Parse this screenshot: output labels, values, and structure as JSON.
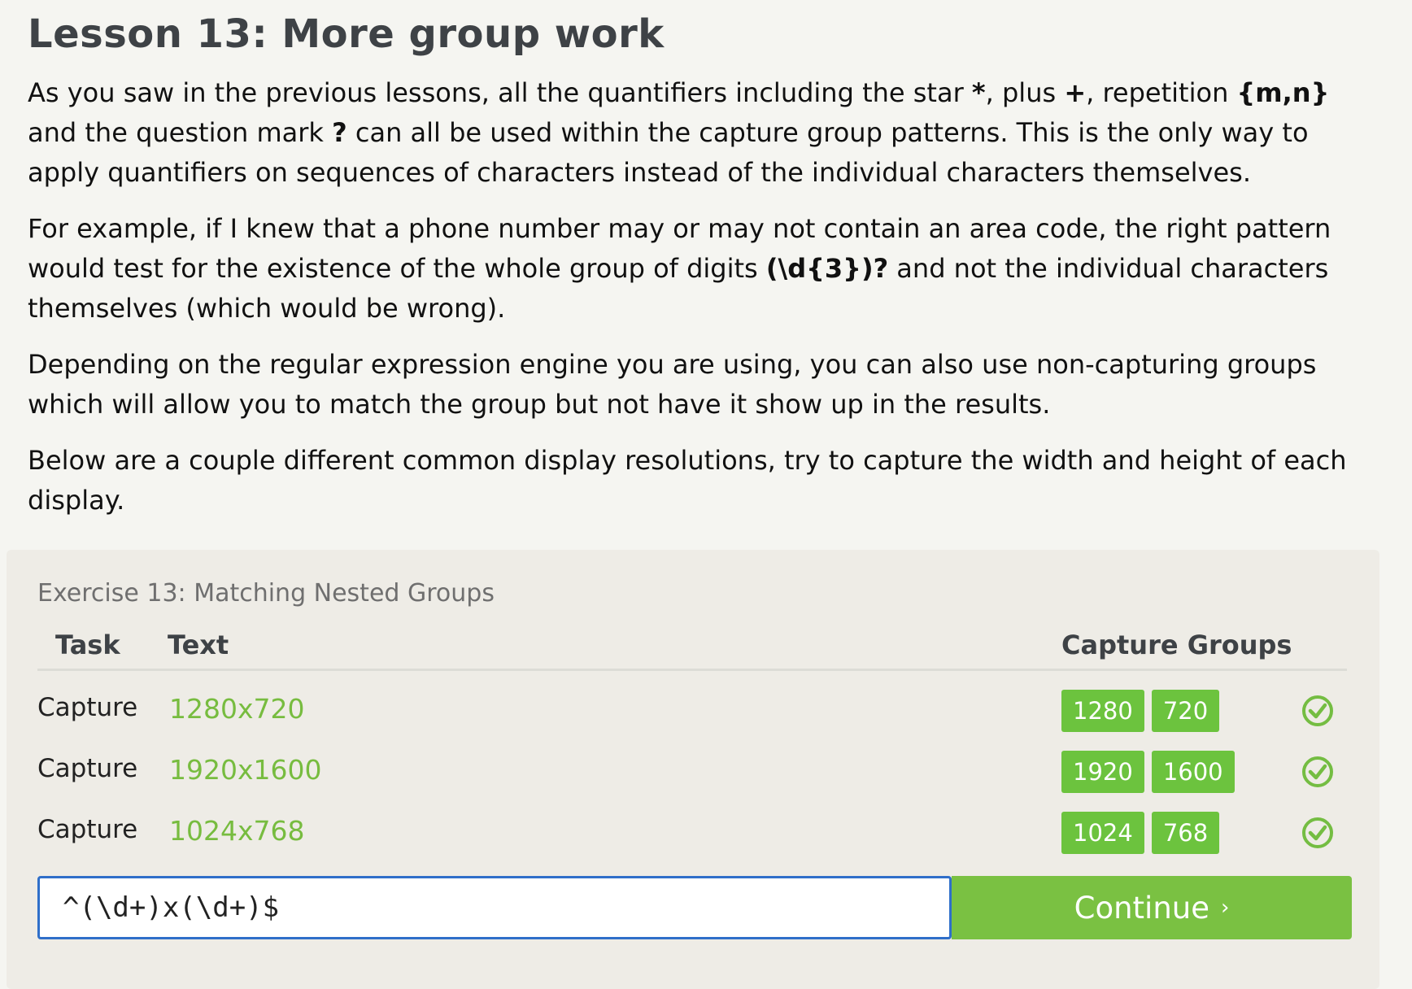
{
  "lesson": {
    "title": "Lesson 13: More group work",
    "p1": {
      "t1": "As you saw in the previous lessons, all the quantifiers including the star ",
      "star": "*",
      "t2": ", plus ",
      "plus": "+",
      "t3": ", repetition ",
      "rep": "{m,n}",
      "t4": " and the question mark ",
      "qmark": "?",
      "t5": " can all be used within the capture group patterns. This is the only way to apply quantifiers on sequences of characters instead of the individual characters themselves."
    },
    "p2": {
      "t1": "For example, if I knew that a phone number may or may not contain an area code, the right pattern would test for the existence of the whole group of digits ",
      "code": "(\\d{3})?",
      "t2": " and not the individual characters themselves (which would be wrong)."
    },
    "p3": "Depending on the regular expression engine you are using, you can also use non-capturing groups which will allow you to match the group but not have it show up in the results.",
    "p4": "Below are a couple different common display resolutions, try to capture the width and height of each display."
  },
  "exercise": {
    "title": "Exercise 13: Matching Nested Groups",
    "headers": {
      "task": "Task",
      "text": "Text",
      "groups": "Capture Groups"
    },
    "rows": [
      {
        "task": "Capture",
        "text": "1280x720",
        "groups": [
          "1280",
          "720"
        ],
        "status": "check-icon"
      },
      {
        "task": "Capture",
        "text": "1920x1600",
        "groups": [
          "1920",
          "1600"
        ],
        "status": "check-icon"
      },
      {
        "task": "Capture",
        "text": "1024x768",
        "groups": [
          "1024",
          "768"
        ],
        "status": "check-icon"
      }
    ],
    "input_value": "^(\\d+)x(\\d+)$",
    "continue_label": "Continue",
    "continue_arrow": "›"
  },
  "colors": {
    "accent_green": "#6cc33e",
    "button_green": "#7ac142",
    "input_border": "#2f6fc9"
  }
}
